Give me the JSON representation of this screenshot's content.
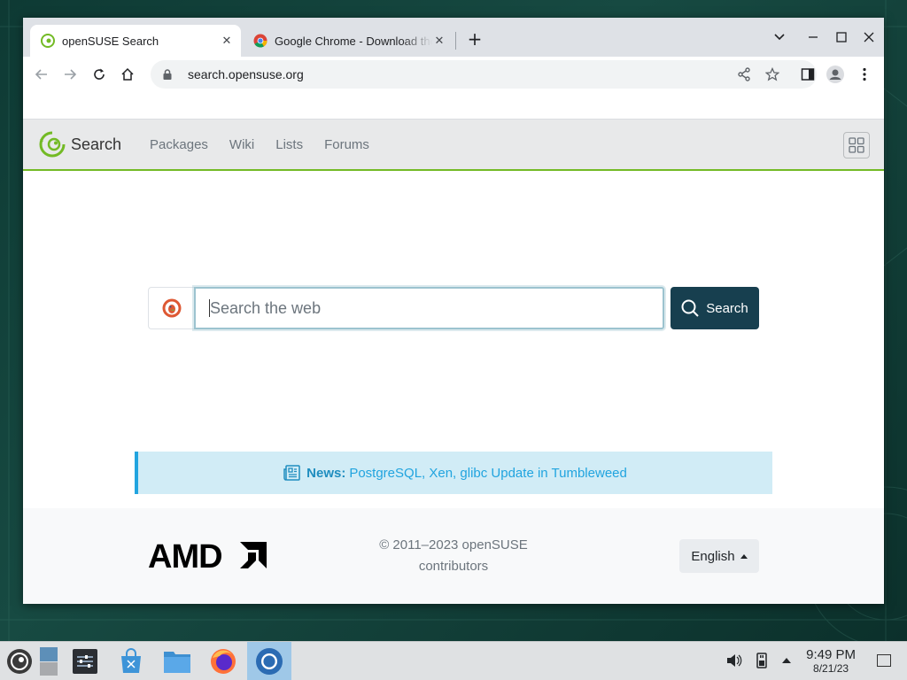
{
  "browser": {
    "tabs": [
      {
        "title": "openSUSE Search",
        "active": true
      },
      {
        "title": "Google Chrome - Download the Fast, Secure Browser from Google",
        "active": false
      }
    ],
    "url": "search.opensuse.org"
  },
  "site": {
    "brand": "Search",
    "nav": [
      "Packages",
      "Wiki",
      "Lists",
      "Forums"
    ]
  },
  "search": {
    "placeholder": "Search the web",
    "button_label": "Search"
  },
  "news": {
    "label": "News:",
    "text": "PostgreSQL, Xen, glibc Update in Tumbleweed"
  },
  "footer": {
    "sponsor": "AMD",
    "copyright_line1": "© 2011–2023 openSUSE",
    "copyright_line2": "contributors",
    "language": "English"
  },
  "taskbar": {
    "time": "9:49 PM",
    "date": "8/21/23"
  },
  "colors": {
    "accent_green": "#73ba25",
    "search_button": "#173f4f",
    "news_bg": "#d1ecf6",
    "news_text": "#21a4df"
  }
}
